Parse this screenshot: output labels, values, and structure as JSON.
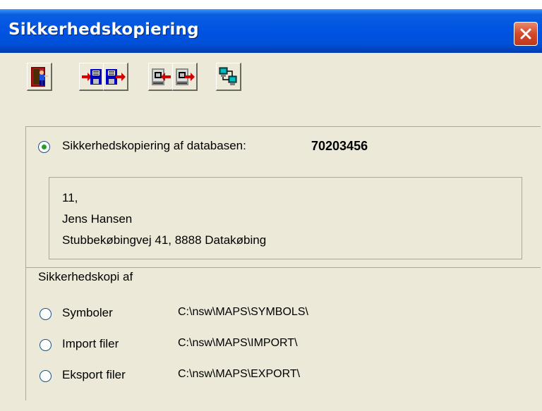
{
  "window": {
    "title": "Sikkerhedskopiering"
  },
  "toolbar": {
    "buttons": [
      {
        "icon": "exit-door-icon",
        "tooltip": ""
      },
      {
        "icon": "save-to-disk-icon",
        "tooltip": ""
      },
      {
        "icon": "load-from-disk-icon",
        "tooltip": ""
      },
      {
        "icon": "import-icon",
        "tooltip": ""
      },
      {
        "icon": "export-icon",
        "tooltip": ""
      },
      {
        "icon": "network-computers-icon",
        "tooltip": ""
      }
    ]
  },
  "database": {
    "label": "Sikkerhedskopiering af databasen:",
    "number": "70203456",
    "selected": true,
    "address": [
      "11,",
      "Jens Hansen",
      "Stubbekøbingvej 41, 8888 Datakøbing"
    ]
  },
  "backup": {
    "heading": "Sikkerhedskopi af",
    "options": [
      {
        "label": "Symboler",
        "path": "C:\\nsw\\MAPS\\SYMBOLS\\",
        "selected": false
      },
      {
        "label": "Import filer",
        "path": "C:\\nsw\\MAPS\\IMPORT\\",
        "selected": false
      },
      {
        "label": "Eksport filer",
        "path": "C:\\nsw\\MAPS\\EXPORT\\",
        "selected": false
      }
    ]
  },
  "colors": {
    "titlebar": "#0054e3",
    "dialog_bg": "#ece9d8",
    "close_button": "#d4492b",
    "radio_dot": "#21a121"
  }
}
